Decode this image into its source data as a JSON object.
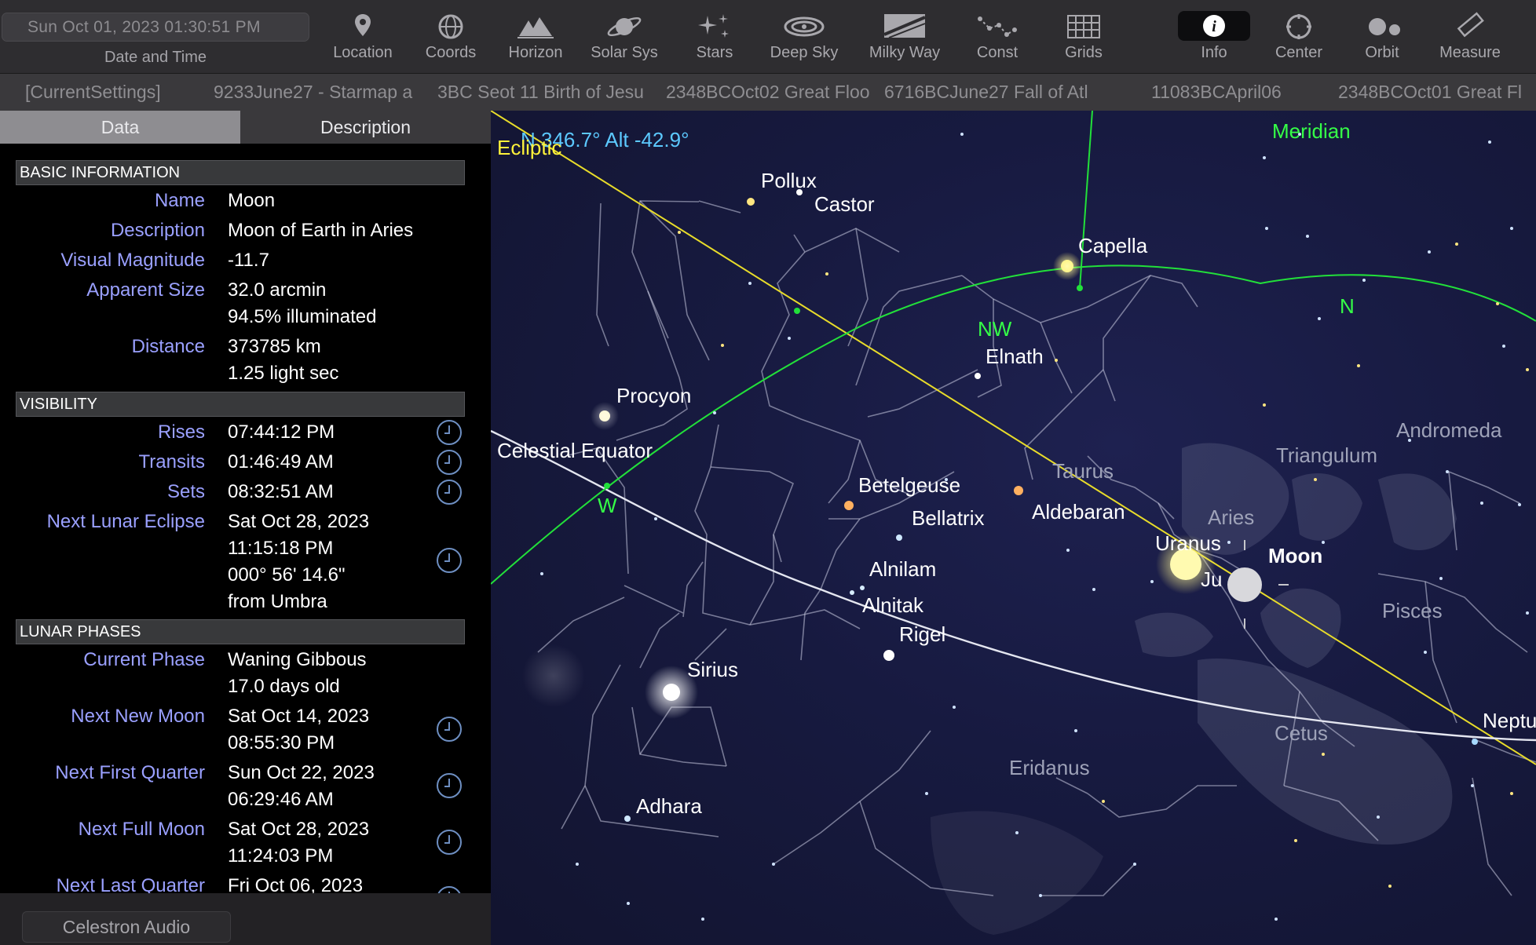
{
  "toolbar": {
    "datetime_value": "Sun Oct 01, 2023  01:30:51 PM",
    "datetime_label": "Date and Time",
    "tools": [
      {
        "label": "Location",
        "icon": "location-pin-icon"
      },
      {
        "label": "Coords",
        "icon": "coords-globe-icon"
      },
      {
        "label": "Horizon",
        "icon": "horizon-mountains-icon"
      },
      {
        "label": "Solar Sys",
        "icon": "planet-icon"
      },
      {
        "label": "Stars",
        "icon": "stars-sparkle-icon"
      },
      {
        "label": "Deep Sky",
        "icon": "galaxy-icon"
      },
      {
        "label": "Milky Way",
        "icon": "milky-way-icon"
      },
      {
        "label": "Const",
        "icon": "constellation-icon"
      },
      {
        "label": "Grids",
        "icon": "grid-icon"
      },
      {
        "label": "Info",
        "icon": "info-icon",
        "active": true
      },
      {
        "label": "Center",
        "icon": "center-target-icon"
      },
      {
        "label": "Orbit",
        "icon": "orbit-icon"
      },
      {
        "label": "Measure",
        "icon": "ruler-icon"
      }
    ]
  },
  "settings_bar": {
    "items": [
      "[CurrentSettings]",
      "9233June27 - Starmap a",
      "3BC Seot 11 Birth of Jesu",
      "2348BCOct02 Great Floo",
      "6716BCJune27 Fall of Atl",
      "11083BCApril06",
      "2348BCOct01 Great Fl"
    ]
  },
  "sidebar": {
    "tabs": {
      "data": "Data",
      "description": "Description"
    },
    "sections": {
      "basic": "BASIC INFORMATION",
      "visibility": "VISIBILITY",
      "lunar": "LUNAR PHASES"
    },
    "basic": {
      "name_label": "Name",
      "name": "Moon",
      "desc_label": "Description",
      "desc": "Moon of Earth in Aries",
      "mag_label": "Visual Magnitude",
      "mag": "-11.7",
      "size_label": "Apparent Size",
      "size": "32.0 arcmin",
      "illum": "94.5% illuminated",
      "dist_label": "Distance",
      "dist_km": "373785 km",
      "dist_ls": "1.25 light sec"
    },
    "visibility": {
      "rises_label": "Rises",
      "rises": "07:44:12 PM",
      "transits_label": "Transits",
      "transits": "01:46:49 AM",
      "sets_label": "Sets",
      "sets": "08:32:51 AM",
      "eclipse_label": "Next Lunar Eclipse",
      "eclipse_date": "Sat Oct 28, 2023",
      "eclipse_time": "11:15:18 PM",
      "eclipse_angle": "000° 56' 14.6\"",
      "eclipse_from": "from Umbra"
    },
    "lunar": {
      "phase_label": "Current Phase",
      "phase": "Waning Gibbous",
      "age": "17.0 days old",
      "new_label": "Next New Moon",
      "new_date": "Sat Oct 14, 2023",
      "new_time": "08:55:30 PM",
      "first_label": "Next First Quarter",
      "first_date": "Sun Oct 22, 2023",
      "first_time": "06:29:46 AM",
      "full_label": "Next Full Moon",
      "full_date": "Sat Oct 28, 2023",
      "full_time": "11:24:03 PM",
      "last_label": "Next Last Quarter",
      "last_date": "Fri Oct 06, 2023"
    },
    "audio_button": "Celestron Audio"
  },
  "sky": {
    "pointer_readout": "N 346.7° Alt -42.9°",
    "lines": {
      "ecliptic": "Ecliptic",
      "meridian": "Meridian",
      "equator": "Celestial Equator"
    },
    "directions": {
      "nw": "NW",
      "n": "N",
      "w": "W"
    },
    "stars": {
      "pollux": "Pollux",
      "castor": "Castor",
      "capella": "Capella",
      "elnath": "Elnath",
      "procyon": "Procyon",
      "betelgeuse": "Betelgeuse",
      "bellatrix": "Bellatrix",
      "aldebaran": "Aldebaran",
      "alnilam": "Alnilam",
      "alnitak": "Alnitak",
      "rigel": "Rigel",
      "sirius": "Sirius",
      "adhara": "Adhara"
    },
    "planets": {
      "uranus": "Uranus",
      "jupiter": "Ju",
      "moon": "Moon",
      "neptune": "Neptu"
    },
    "constellations": {
      "taurus": "Taurus",
      "aries": "Aries",
      "triangulum": "Triangulum",
      "andromeda": "Andromeda",
      "pisces": "Pisces",
      "cetus": "Cetus",
      "eridanus": "Eridanus"
    }
  }
}
